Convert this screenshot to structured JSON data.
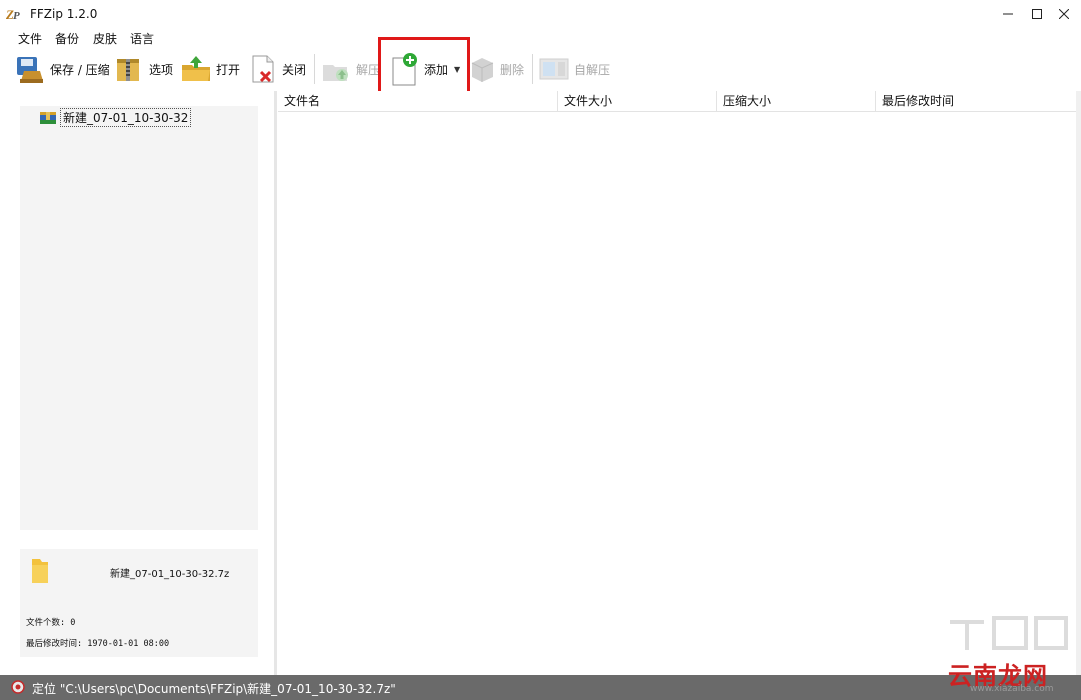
{
  "window": {
    "title": "FFZip 1.2.0"
  },
  "menu": [
    "文件",
    "备份",
    "皮肤",
    "语言"
  ],
  "toolbar": {
    "save": "保存 / 压缩",
    "options": "选项",
    "open": "打开",
    "close": "关闭",
    "extract": "解压",
    "add": "添加",
    "delete": "删除",
    "sfx": "自解压"
  },
  "tree": {
    "archive": "新建_07-01_10-30-32"
  },
  "info": {
    "filename": "新建_07-01_10-30-32.7z",
    "file_count": "文件个数: 0",
    "modified": "最后修改时间: 1970-01-01 08:00"
  },
  "list": {
    "columns": [
      "文件名",
      "文件大小",
      "压缩大小",
      "最后修改时间"
    ]
  },
  "status": {
    "text": "定位 \"C:\\Users\\pc\\Documents\\FFZip\\新建_07-01_10-30-32.7z\""
  },
  "watermark": {
    "main": "云南龙网",
    "url": "www.xiazaiba.com"
  },
  "colors": {
    "highlight": "#e01818",
    "status_bg": "#6a6a6a",
    "panel_bg": "#f4f4f4"
  }
}
